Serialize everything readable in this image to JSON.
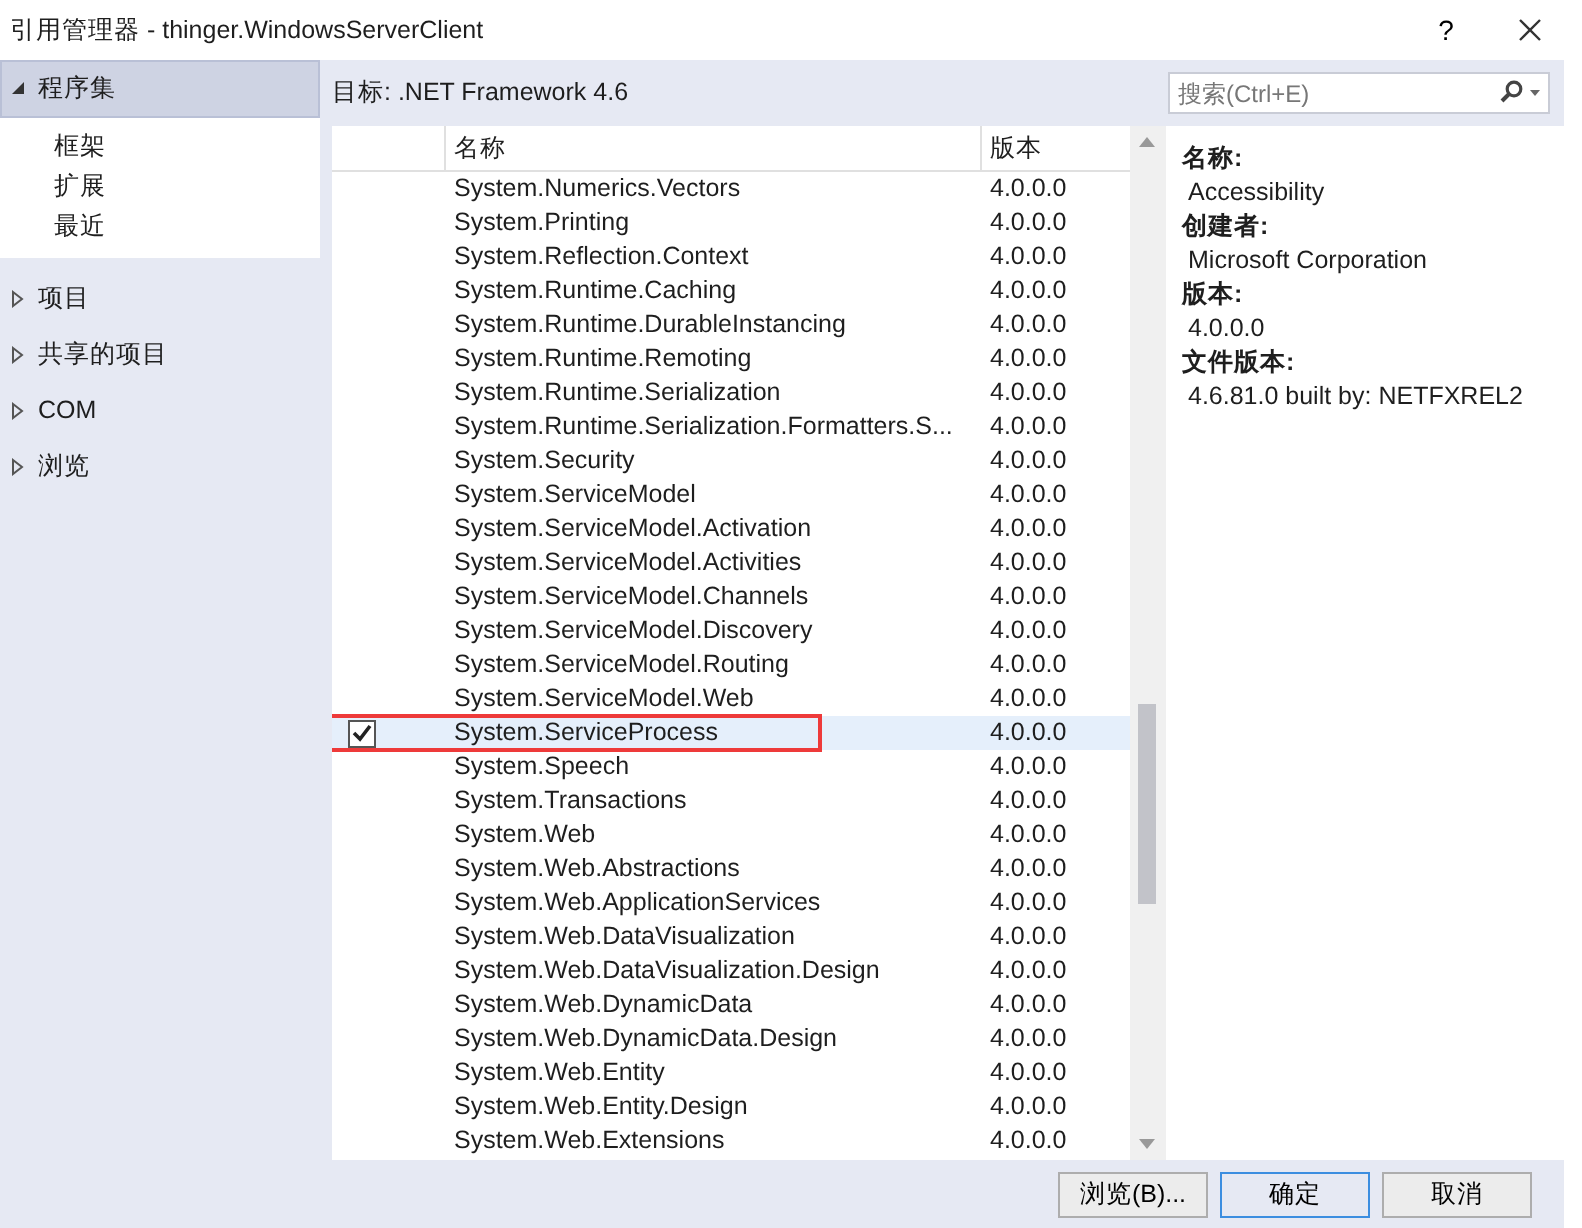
{
  "window": {
    "title": "引用管理器 - thinger.WindowsServerClient",
    "help": "?"
  },
  "sidebar": {
    "groups": [
      {
        "label": "程序集",
        "expanded": true,
        "selected": true,
        "children": [
          {
            "label": "框架",
            "selected": false
          },
          {
            "label": "扩展",
            "selected": false
          },
          {
            "label": "最近",
            "selected": false
          }
        ]
      },
      {
        "label": "项目",
        "expanded": false,
        "selected": false
      },
      {
        "label": "共享的项目",
        "expanded": false,
        "selected": false
      },
      {
        "label": "COM",
        "expanded": false,
        "selected": false
      },
      {
        "label": "浏览",
        "expanded": false,
        "selected": false
      }
    ]
  },
  "target": "目标: .NET Framework 4.6",
  "search": {
    "placeholder": "搜索(Ctrl+E)"
  },
  "table": {
    "columns": [
      "名称",
      "版本"
    ],
    "rows": [
      {
        "name": "System.Numerics.Vectors",
        "version": "4.0.0.0",
        "checked": false,
        "selected": false,
        "boxed": false
      },
      {
        "name": "System.Printing",
        "version": "4.0.0.0",
        "checked": false,
        "selected": false,
        "boxed": false
      },
      {
        "name": "System.Reflection.Context",
        "version": "4.0.0.0",
        "checked": false,
        "selected": false,
        "boxed": false
      },
      {
        "name": "System.Runtime.Caching",
        "version": "4.0.0.0",
        "checked": false,
        "selected": false,
        "boxed": false
      },
      {
        "name": "System.Runtime.DurableInstancing",
        "version": "4.0.0.0",
        "checked": false,
        "selected": false,
        "boxed": false
      },
      {
        "name": "System.Runtime.Remoting",
        "version": "4.0.0.0",
        "checked": false,
        "selected": false,
        "boxed": false
      },
      {
        "name": "System.Runtime.Serialization",
        "version": "4.0.0.0",
        "checked": false,
        "selected": false,
        "boxed": false
      },
      {
        "name": "System.Runtime.Serialization.Formatters.S...",
        "version": "4.0.0.0",
        "checked": false,
        "selected": false,
        "boxed": false
      },
      {
        "name": "System.Security",
        "version": "4.0.0.0",
        "checked": false,
        "selected": false,
        "boxed": false
      },
      {
        "name": "System.ServiceModel",
        "version": "4.0.0.0",
        "checked": false,
        "selected": false,
        "boxed": false
      },
      {
        "name": "System.ServiceModel.Activation",
        "version": "4.0.0.0",
        "checked": false,
        "selected": false,
        "boxed": false
      },
      {
        "name": "System.ServiceModel.Activities",
        "version": "4.0.0.0",
        "checked": false,
        "selected": false,
        "boxed": false
      },
      {
        "name": "System.ServiceModel.Channels",
        "version": "4.0.0.0",
        "checked": false,
        "selected": false,
        "boxed": false
      },
      {
        "name": "System.ServiceModel.Discovery",
        "version": "4.0.0.0",
        "checked": false,
        "selected": false,
        "boxed": false
      },
      {
        "name": "System.ServiceModel.Routing",
        "version": "4.0.0.0",
        "checked": false,
        "selected": false,
        "boxed": false
      },
      {
        "name": "System.ServiceModel.Web",
        "version": "4.0.0.0",
        "checked": false,
        "selected": false,
        "boxed": false
      },
      {
        "name": "System.ServiceProcess",
        "version": "4.0.0.0",
        "checked": true,
        "selected": true,
        "boxed": true
      },
      {
        "name": "System.Speech",
        "version": "4.0.0.0",
        "checked": false,
        "selected": false,
        "boxed": false
      },
      {
        "name": "System.Transactions",
        "version": "4.0.0.0",
        "checked": false,
        "selected": false,
        "boxed": false
      },
      {
        "name": "System.Web",
        "version": "4.0.0.0",
        "checked": false,
        "selected": false,
        "boxed": false
      },
      {
        "name": "System.Web.Abstractions",
        "version": "4.0.0.0",
        "checked": false,
        "selected": false,
        "boxed": false
      },
      {
        "name": "System.Web.ApplicationServices",
        "version": "4.0.0.0",
        "checked": false,
        "selected": false,
        "boxed": false
      },
      {
        "name": "System.Web.DataVisualization",
        "version": "4.0.0.0",
        "checked": false,
        "selected": false,
        "boxed": false
      },
      {
        "name": "System.Web.DataVisualization.Design",
        "version": "4.0.0.0",
        "checked": false,
        "selected": false,
        "boxed": false
      },
      {
        "name": "System.Web.DynamicData",
        "version": "4.0.0.0",
        "checked": false,
        "selected": false,
        "boxed": false
      },
      {
        "name": "System.Web.DynamicData.Design",
        "version": "4.0.0.0",
        "checked": false,
        "selected": false,
        "boxed": false
      },
      {
        "name": "System.Web.Entity",
        "version": "4.0.0.0",
        "checked": false,
        "selected": false,
        "boxed": false
      },
      {
        "name": "System.Web.Entity.Design",
        "version": "4.0.0.0",
        "checked": false,
        "selected": false,
        "boxed": false
      },
      {
        "name": "System.Web.Extensions",
        "version": "4.0.0.0",
        "checked": false,
        "selected": false,
        "boxed": false
      }
    ]
  },
  "details": [
    {
      "label": "名称:",
      "value": "Accessibility"
    },
    {
      "label": "创建者:",
      "value": "Microsoft Corporation"
    },
    {
      "label": "版本:",
      "value": "4.0.0.0"
    },
    {
      "label": "文件版本:",
      "value": "4.6.81.0 built by: NETFXREL2"
    }
  ],
  "buttons": [
    {
      "label": "浏览(B)...",
      "default": false
    },
    {
      "label": "确定",
      "default": true
    },
    {
      "label": "取消",
      "default": false
    }
  ]
}
